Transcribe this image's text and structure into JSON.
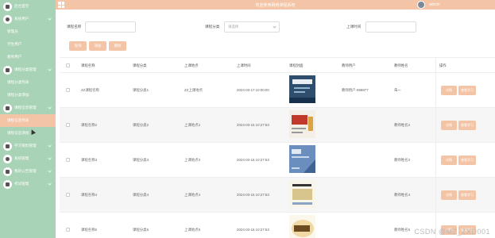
{
  "header": {
    "title": "欢迎使用网络课程系统",
    "user": "admin"
  },
  "sidebar": {
    "items": [
      {
        "label": "后台首页",
        "type": "top",
        "icon": "home-icon"
      },
      {
        "label": "系统用户",
        "type": "top",
        "icon": "user-icon",
        "expandable": true
      },
      {
        "label": "管理员",
        "type": "sub"
      },
      {
        "label": "学生用户",
        "type": "sub"
      },
      {
        "label": "教师用户",
        "type": "sub"
      },
      {
        "label": "课程分类管理",
        "type": "top",
        "icon": "category-icon",
        "expandable": true
      },
      {
        "label": "课程分类列表",
        "type": "sub"
      },
      {
        "label": "课程分类添加",
        "type": "sub"
      },
      {
        "label": "课程信息管理",
        "type": "top",
        "icon": "document-icon",
        "expandable": true
      },
      {
        "label": "课程信息列表",
        "type": "sub",
        "active": true
      },
      {
        "label": "课程信息添加",
        "type": "sub"
      },
      {
        "label": "学习资料管理",
        "type": "top",
        "icon": "folder-icon",
        "expandable": true
      },
      {
        "label": "系统管理",
        "type": "top",
        "icon": "settings-icon",
        "expandable": true
      },
      {
        "label": "我的公告管理",
        "type": "top",
        "icon": "notice-icon",
        "expandable": true
      },
      {
        "label": "考试管理",
        "type": "top",
        "icon": "exam-icon",
        "expandable": true
      }
    ]
  },
  "search": {
    "name_label": "课程名称",
    "category_label": "课程分类",
    "category_placeholder": "请选择",
    "time_label": "上课时间",
    "buttons": {
      "search": "查询",
      "add": "添加",
      "delete": "删除"
    }
  },
  "table": {
    "headers": [
      "课程名称",
      "课程分类",
      "上课地点",
      "上课时间",
      "课程封面",
      "教师用户",
      "教师姓名",
      "操作"
    ],
    "rows": [
      {
        "name": "ZZ课程名称",
        "category": "课程分类1",
        "place": "ZZ上课地点",
        "time": "2024-03-17 10:00:00",
        "teacher": "教师用户-998877",
        "teacher_name": "朱一"
      },
      {
        "name": "课程名称2",
        "category": "课程分类2",
        "place": "上课地点2",
        "time": "2024-03-16 10:27:53",
        "teacher": "",
        "teacher_name": "教师姓名2"
      },
      {
        "name": "课程名称3",
        "category": "课程分类3",
        "place": "上课地点3",
        "time": "2024-03-16 10:27:53",
        "teacher": "",
        "teacher_name": "教师姓名3"
      },
      {
        "name": "课程名称4",
        "category": "课程分类4",
        "place": "上课地点4",
        "time": "2024-03-16 10:27:53",
        "teacher": "",
        "teacher_name": "教师姓名4"
      },
      {
        "name": "课程名称5",
        "category": "课程分类5",
        "place": "上课地点5",
        "time": "2024-03-16 10:27:53",
        "teacher": "",
        "teacher_name": "教师姓名5"
      }
    ],
    "action_detail": "详情",
    "action_study": "查看学习"
  },
  "watermark": "CSDN @MZ_ZXD001",
  "colors": {
    "sidebar": "#a9d3b6",
    "accent": "#f3c4a6"
  }
}
